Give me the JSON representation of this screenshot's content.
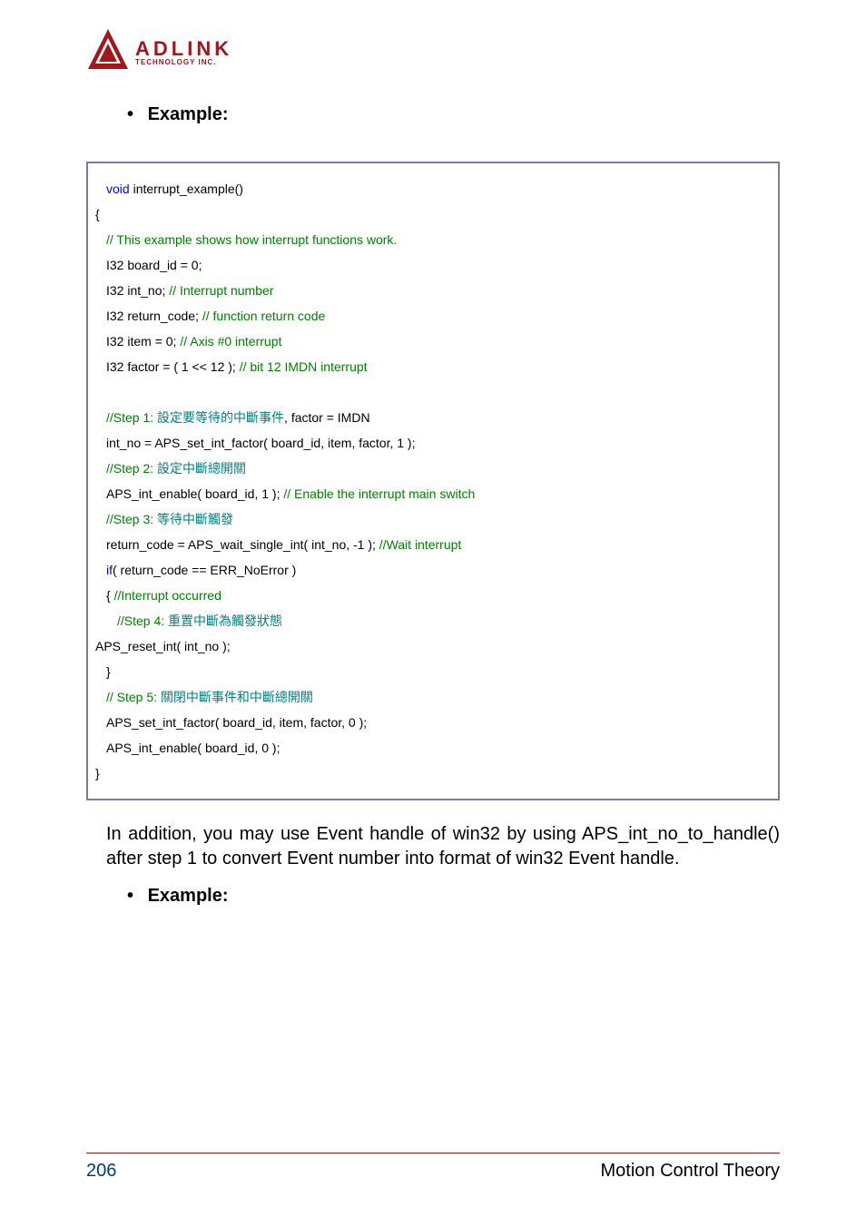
{
  "logo": {
    "brand": "ADLINK",
    "sub": "TECHNOLOGY INC."
  },
  "sections": {
    "heading1": "Example:",
    "heading2": "Example:",
    "bullet": "•"
  },
  "code": {
    "l1a": "void",
    "l1b": " interrupt_example()",
    "l2": "{",
    "l3": "// This example shows how interrupt functions work.",
    "l4": "I32 board_id = 0;",
    "l5a": "I32 int_no;    ",
    "l5b": "// Interrupt number",
    "l6a": "I32 return_code; ",
    "l6b": "// function return code",
    "l7a": "I32 item = 0;   ",
    "l7b": "// Axis #0 interrupt",
    "l8a": "I32 factor = ( 1 << 12 ); ",
    "l8b": "// bit 12 IMDN interrupt",
    "s1a": "//Step 1: ",
    "s1b": "設定要等待的中斷事件",
    "s1c": ", factor = IMDN",
    "l9": "int_no = APS_set_int_factor( board_id, item, factor, 1 );",
    "s2a": "//Step 2: ",
    "s2b": "設定中斷總開關",
    "l10a": "APS_int_enable( board_id, 1 ); ",
    "l10b": "// Enable the interrupt main switch",
    "s3a": "//Step 3: ",
    "s3b": "等待中斷觸發",
    "l11a": "return_code = APS_wait_single_int( int_no, -1 ); ",
    "l11b": "//Wait interrupt",
    "l12a": "if",
    "l12b": "( return_code == ERR_NoError )",
    "l13a": "{ ",
    "l13b": "//Interrupt occurred",
    "s4a": "//Step 4: ",
    "s4b": "重置中斷為觸發狀態",
    "l14": "APS_reset_int( int_no );",
    "l15": "}",
    "s5a": "// Step 5: ",
    "s5b": "關閉中斷事件和中斷總開關",
    "l16": "APS_set_int_factor( board_id, item, factor, 0 );",
    "l17": "APS_int_enable( board_id, 0 );",
    "l18": "}"
  },
  "body": {
    "paragraph": "In addition, you may use Event handle of win32 by using APS_int_no_to_handle() after step 1 to convert Event number into format of win32 Event handle."
  },
  "footer": {
    "page": "206",
    "title": "Motion Control Theory"
  }
}
